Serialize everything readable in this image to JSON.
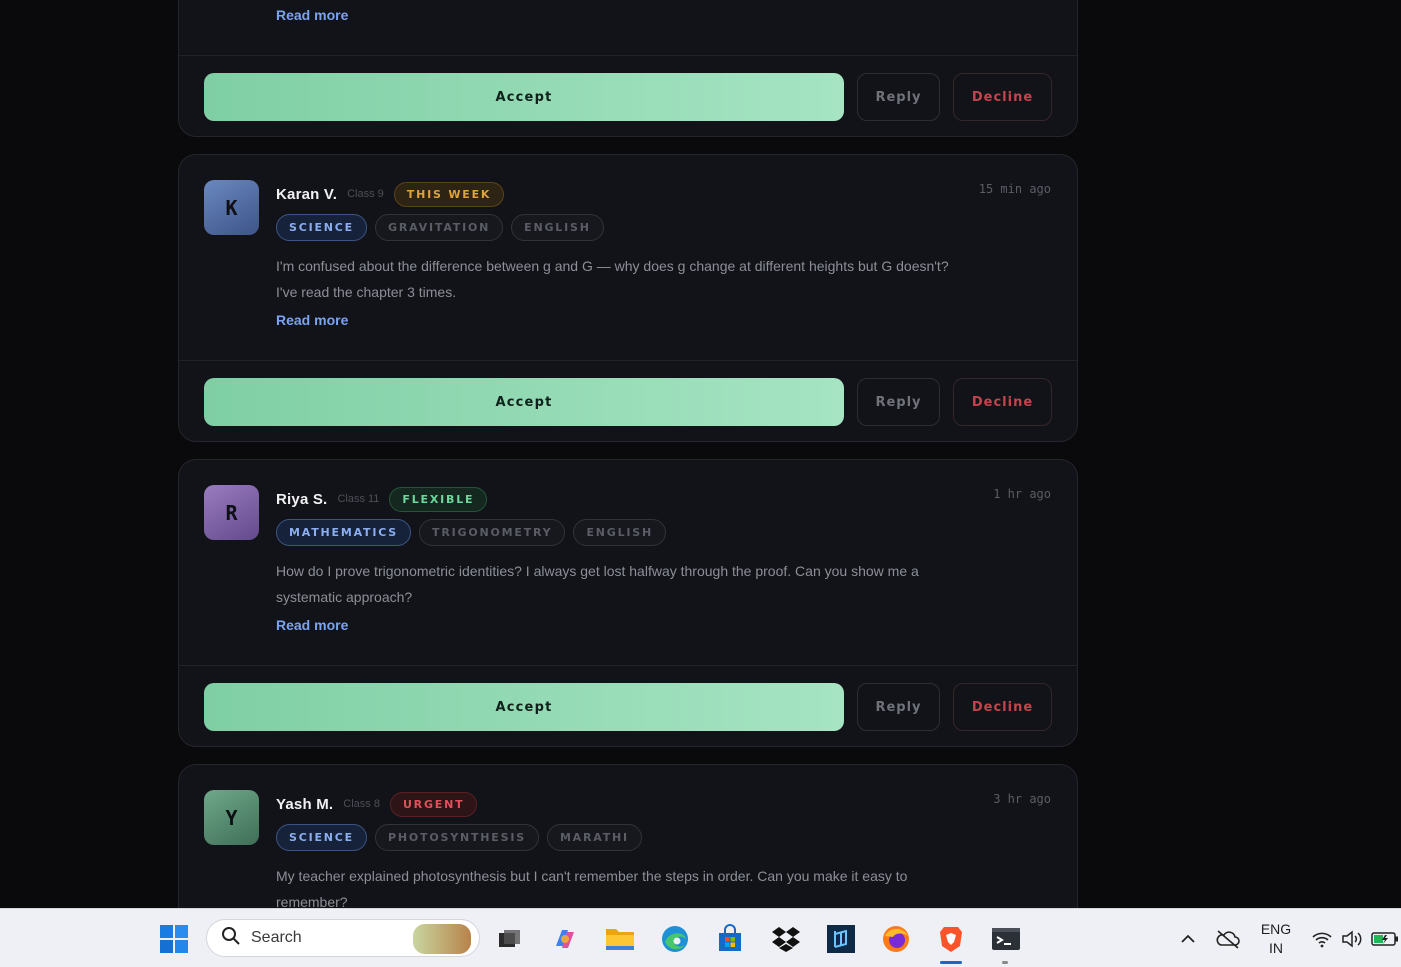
{
  "cards": [
    {
      "read_more": "Read more",
      "accept_label": "Accept",
      "reply_label": "Reply",
      "decline_label": "Decline"
    },
    {
      "avatar_letter": "K",
      "name": "Karan V.",
      "class_label": "Class 9",
      "badge": "THIS WEEK",
      "time": "15 min ago",
      "tags": [
        "SCIENCE",
        "GRAVITATION",
        "ENGLISH"
      ],
      "message": "I'm confused about the difference between g and G — why does g change at different heights but G doesn't? I've read the chapter 3 times.",
      "read_more": "Read more",
      "accept_label": "Accept",
      "reply_label": "Reply",
      "decline_label": "Decline"
    },
    {
      "avatar_letter": "R",
      "name": "Riya S.",
      "class_label": "Class 11",
      "badge": "FLEXIBLE",
      "time": "1 hr ago",
      "tags": [
        "MATHEMATICS",
        "TRIGONOMETRY",
        "ENGLISH"
      ],
      "message": "How do I prove trigonometric identities? I always get lost halfway through the proof. Can you show me a systematic approach?",
      "read_more": "Read more",
      "accept_label": "Accept",
      "reply_label": "Reply",
      "decline_label": "Decline"
    },
    {
      "avatar_letter": "Y",
      "name": "Yash M.",
      "class_label": "Class 8",
      "badge": "URGENT",
      "time": "3 hr ago",
      "tags": [
        "SCIENCE",
        "PHOTOSYNTHESIS",
        "MARATHI"
      ],
      "message": "My teacher explained photosynthesis but I can't remember the steps in order. Can you make it easy to remember?"
    }
  ],
  "taskbar": {
    "search_placeholder": "Search",
    "lang_line1": "ENG",
    "lang_line2": "IN",
    "icons": [
      "windows-start-icon",
      "search-icon",
      "task-view-icon",
      "copilot-icon",
      "file-explorer-icon",
      "edge-icon",
      "store-icon",
      "dropbox-icon",
      "app-icon",
      "firefox-icon",
      "brave-icon",
      "terminal-icon",
      "chevron-up-icon",
      "cloud-off-icon",
      "wifi-icon",
      "volume-icon",
      "battery-icon"
    ]
  }
}
